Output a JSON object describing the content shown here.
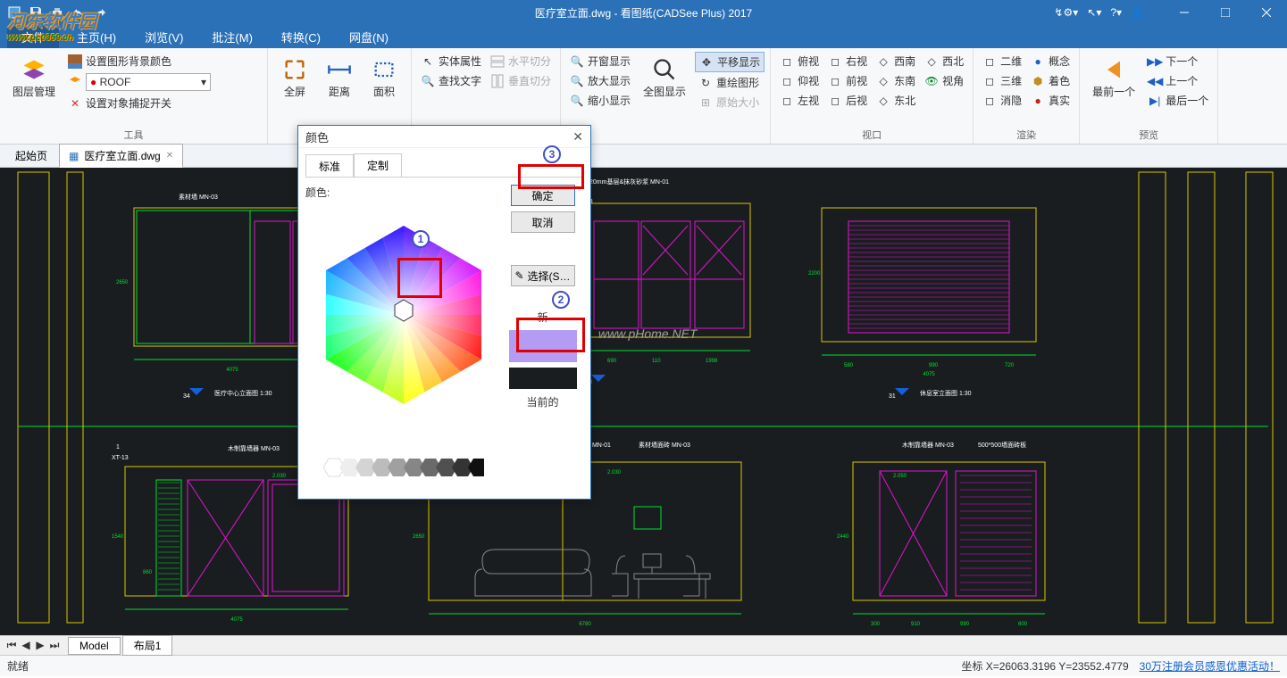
{
  "title_bar": {
    "app_title": "医疗室立面.dwg - 看图纸(CADSee Plus) 2017"
  },
  "watermark_top": {
    "line1": "河东软件园",
    "line2": "www.pc0359.cn"
  },
  "menu": {
    "file": "文件",
    "home": "主页(H)",
    "view": "浏览(V)",
    "annotate": "批注(M)",
    "convert": "转换(C)",
    "cloud": "网盘(N)"
  },
  "ribbon": {
    "layer_mgr": "图层管理",
    "bg_color": "设置图形背景颜色",
    "layer_select": "ROOF",
    "object_snap": "设置对象捕捉开关",
    "tools_group": "工具",
    "fullscreen": "全屏",
    "distance": "距离",
    "area": "面积",
    "entity_prop": "实体属性",
    "find_text": "查找文字",
    "h_split": "水平切分",
    "v_split": "垂直切分",
    "zoom_window": "开窗显示",
    "zoom_in": "放大显示",
    "zoom_out": "缩小显示",
    "zoom_all": "全图显示",
    "pan": "平移显示",
    "redraw": "重绘图形",
    "orig_size": "原始大小",
    "viewport_group": "视口",
    "top": "俯视",
    "right": "右视",
    "sw": "西南",
    "nw": "西北",
    "up": "仰视",
    "front": "前视",
    "se": "东南",
    "angle": "视角",
    "left": "左视",
    "back": "后视",
    "ne": "东北",
    "render_group": "渲染",
    "d2": "二维",
    "concept": "概念",
    "d3": "三维",
    "shade": "着色",
    "hide": "消隐",
    "real": "真实",
    "prev_group": "预览",
    "prev_one": "最前一个",
    "next": "下一个",
    "prev": "上一个",
    "last": "最后一个"
  },
  "doc_tabs": {
    "start": "起始页",
    "doc1": "医疗室立面.dwg"
  },
  "dialog": {
    "title": "颜色",
    "tab_standard": "标准",
    "tab_custom": "定制",
    "color_label": "颜色:",
    "ok": "确定",
    "cancel": "取消",
    "pick": "选择(S…",
    "new": "新",
    "current": "当前的"
  },
  "canvas_watermark": "www.pHome.NET",
  "model_tabs": {
    "model": "Model",
    "layout1": "布局1"
  },
  "status": {
    "ready": "就绪",
    "coord": "坐标 X=26063.3196 Y=23552.4779",
    "promo": "30万注册会员感恩优惠活动！"
  }
}
